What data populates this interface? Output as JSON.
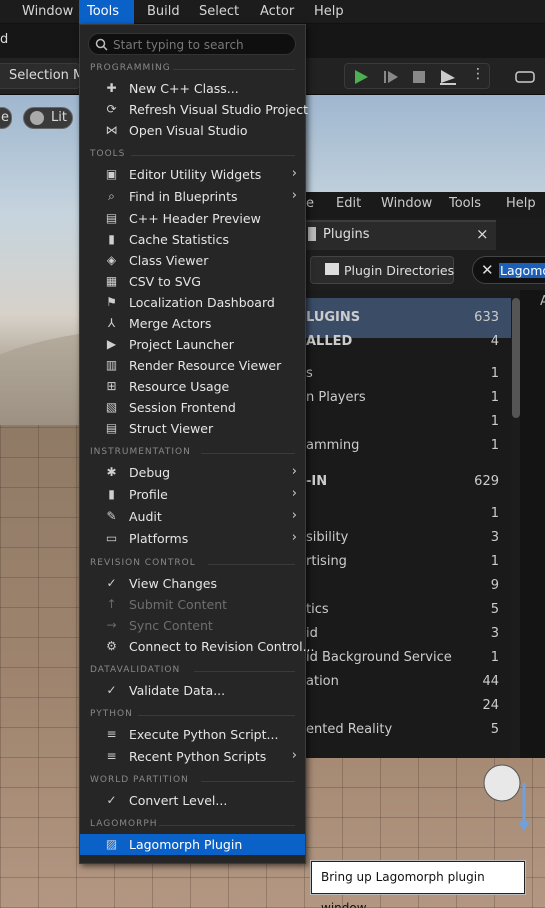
{
  "menubar": {
    "items": [
      "Window",
      "Tools",
      "Build",
      "Select",
      "Actor",
      "Help"
    ],
    "active": "Tools"
  },
  "toolbar": {
    "title_fragment": "d",
    "selection_mode": "Selection Mo",
    "view_fragment": "e",
    "lit_label": "Lit"
  },
  "plugins_window": {
    "menu": [
      "e",
      "Edit",
      "Window",
      "Tools",
      "Help"
    ],
    "tab_title": "Plugins",
    "close": "×",
    "dir_button": "Plugin Directories",
    "search_value": "Lagomorph",
    "col_fragment": "A",
    "rows": [
      {
        "label": "LUGINS",
        "count": "633",
        "bold": true,
        "selected": true
      },
      {
        "label": "ALLED",
        "count": "4",
        "bold": true
      },
      {
        "label": "s",
        "count": "1"
      },
      {
        "label": "n Players",
        "count": "1"
      },
      {
        "label": "",
        "count": "1"
      },
      {
        "label": "amming",
        "count": "1"
      },
      {
        "label": "-IN",
        "count": "629",
        "bold": true
      },
      {
        "label": "",
        "count": "1"
      },
      {
        "label": "sibility",
        "count": "3"
      },
      {
        "label": "rtising",
        "count": "1"
      },
      {
        "label": "",
        "count": "9"
      },
      {
        "label": "tics",
        "count": "5"
      },
      {
        "label": "id",
        "count": "3"
      },
      {
        "label": "id Background Service",
        "count": "1"
      },
      {
        "label": "ation",
        "count": "44"
      },
      {
        "label": "",
        "count": "24"
      },
      {
        "label": "ented Reality",
        "count": "5"
      }
    ]
  },
  "menu": {
    "search_placeholder": "Start typing to search",
    "sections": [
      {
        "title": "PROGRAMMING",
        "items": [
          {
            "label": "New C++ Class...",
            "icon": "file-plus-icon"
          },
          {
            "label": "Refresh Visual Studio Project",
            "icon": "refresh-icon"
          },
          {
            "label": "Open Visual Studio",
            "icon": "visual-studio-icon"
          }
        ]
      },
      {
        "title": "TOOLS",
        "items": [
          {
            "label": "Editor Utility Widgets",
            "icon": "widget-icon",
            "submenu": true
          },
          {
            "label": "Find in Blueprints",
            "icon": "find-icon",
            "submenu": true
          },
          {
            "label": "C++ Header Preview",
            "icon": "header-icon"
          },
          {
            "label": "Cache Statistics",
            "icon": "chart-icon"
          },
          {
            "label": "Class Viewer",
            "icon": "class-icon"
          },
          {
            "label": "CSV to SVG",
            "icon": "csv-icon"
          },
          {
            "label": "Localization Dashboard",
            "icon": "flag-icon"
          },
          {
            "label": "Merge Actors",
            "icon": "merge-icon"
          },
          {
            "label": "Project Launcher",
            "icon": "launcher-icon"
          },
          {
            "label": "Render Resource Viewer",
            "icon": "render-icon"
          },
          {
            "label": "Resource Usage",
            "icon": "table-icon"
          },
          {
            "label": "Session Frontend",
            "icon": "session-icon"
          },
          {
            "label": "Struct Viewer",
            "icon": "struct-icon"
          }
        ]
      },
      {
        "title": "INSTRUMENTATION",
        "items": [
          {
            "label": "Debug",
            "icon": "bug-icon",
            "submenu": true
          },
          {
            "label": "Profile",
            "icon": "profile-icon",
            "submenu": true
          },
          {
            "label": "Audit",
            "icon": "audit-icon",
            "submenu": true
          },
          {
            "label": "Platforms",
            "icon": "platforms-icon",
            "submenu": true
          }
        ]
      },
      {
        "title": "REVISION CONTROL",
        "items": [
          {
            "label": "View Changes",
            "icon": "check-circle-icon"
          },
          {
            "label": "Submit Content",
            "icon": "submit-icon",
            "disabled": true
          },
          {
            "label": "Sync Content",
            "icon": "sync-icon",
            "disabled": true
          },
          {
            "label": "Connect to Revision Control...",
            "icon": "connect-icon"
          }
        ]
      },
      {
        "title": "DATAVALIDATION",
        "items": [
          {
            "label": "Validate Data...",
            "icon": "validate-icon"
          }
        ]
      },
      {
        "title": "PYTHON",
        "items": [
          {
            "label": "Execute Python Script...",
            "icon": "python-icon"
          },
          {
            "label": "Recent Python Scripts",
            "icon": "recent-icon",
            "submenu": true
          }
        ]
      },
      {
        "title": "WORLD PARTITION",
        "items": [
          {
            "label": "Convert Level...",
            "icon": "convert-icon"
          }
        ]
      },
      {
        "title": "LAGOMORPH",
        "items": [
          {
            "label": "Lagomorph Plugin",
            "icon": "lagomorph-icon",
            "highlighted": true
          }
        ]
      }
    ]
  },
  "tooltip": "Bring up Lagomorph plugin window",
  "colors": {
    "accent": "#0a62c9",
    "menu_bg": "#262626",
    "play": "#4caf50"
  }
}
